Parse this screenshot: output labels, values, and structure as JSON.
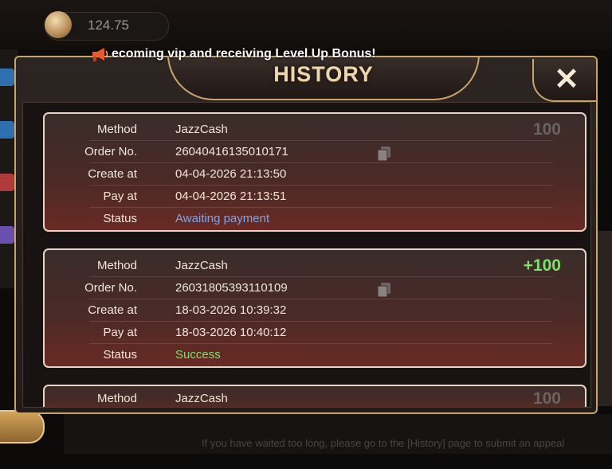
{
  "balance": "124.75",
  "marquee": "ecoming vip and receiving Level Up Bonus!",
  "modal": {
    "title": "HISTORY",
    "close_label": "✕"
  },
  "labels": {
    "method": "Method",
    "order_no": "Order No.",
    "create_at": "Create at",
    "pay_at": "Pay at",
    "status": "Status"
  },
  "records": [
    {
      "method": "JazzCash",
      "order_no": "26040416135010171",
      "create_at": "04-04-2026 21:13:50",
      "pay_at": "04-04-2026 21:13:51",
      "status": "Awaiting payment",
      "amount": "100"
    },
    {
      "method": "JazzCash",
      "order_no": "26031805393110109",
      "create_at": "18-03-2026 10:39:32",
      "pay_at": "18-03-2026 10:40:12",
      "status": "Success",
      "amount": "+100"
    },
    {
      "method": "JazzCash",
      "amount": "100"
    }
  ],
  "footer_hint": "If you have waited too long, please go to the [History] page to submit an appeal",
  "colors": {
    "gold_border": "#c9a46a",
    "awaiting": "#7fa3e4",
    "success": "#7de06a"
  }
}
